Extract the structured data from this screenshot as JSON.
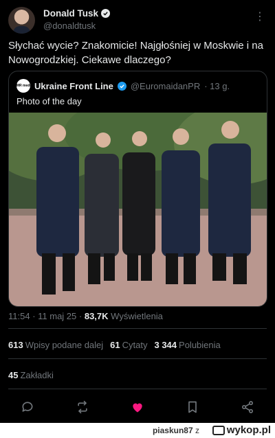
{
  "post": {
    "author_name": "Donald Tusk",
    "author_handle": "@donaldtusk",
    "text": "Słychać wycie? Znakomicie! Najgłośniej w Moskwie i na Nowogrodzkiej. Ciekawe dlaczego?"
  },
  "quote": {
    "source_logo_text": "EMR media",
    "author_name": "Ukraine Front Line",
    "author_handle": "@EuromaidanPR",
    "time": "· 13 g.",
    "text": "Photo of the day"
  },
  "meta": {
    "time": "11:54",
    "sep1": " · ",
    "date": "11 maj 25",
    "sep2": " · ",
    "views": "83,7K",
    "views_label": "Wyświetlenia"
  },
  "stats": {
    "reposts": "613",
    "reposts_label": "Wpisy podane dalej",
    "quotes": "61",
    "quotes_label": "Cytaty",
    "likes": "3 344",
    "likes_label": "Polubienia",
    "bookmarks": "45",
    "bookmarks_label": "Zakładki"
  },
  "icons": [
    "verified-badge-icon",
    "more-options-icon",
    "reply-icon",
    "repost-icon",
    "like-icon",
    "bookmark-icon",
    "share-icon"
  ],
  "colors": {
    "like": "#f91880",
    "muted": "#71767b",
    "text": "#e7e9ea",
    "background": "#000000"
  },
  "footer": {
    "user": "piaskun87",
    "sep": "z",
    "site": "wykop.pl"
  }
}
